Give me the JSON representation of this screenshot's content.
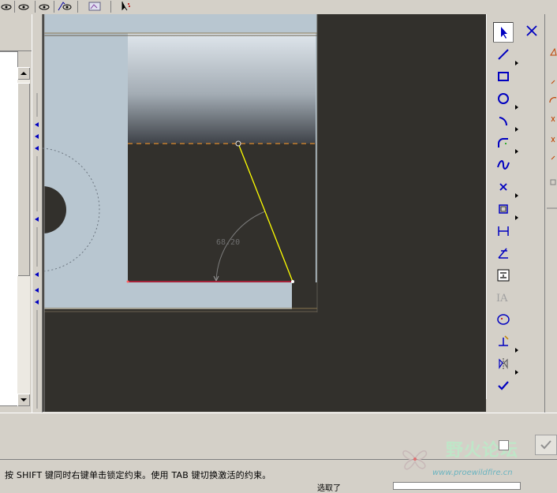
{
  "toolbar": {
    "icons": [
      "eye-icon",
      "eye-icon",
      "eye-icon",
      "layer-icon",
      "select-arrow-icon"
    ]
  },
  "sketch": {
    "angle_dimension": "68.20",
    "colors": {
      "background": "#32302c",
      "part_fill": "#b8c6d0",
      "highlight_line": "#ffff00",
      "selected_line": "#c81e3c",
      "reference_line": "#e08c2c",
      "tool_icon": "#0000c0"
    }
  },
  "sketch_tools": {
    "items": [
      {
        "name": "select",
        "icon": "arrow-cursor-icon",
        "has_menu": false
      },
      {
        "name": "line",
        "icon": "line-icon",
        "has_menu": true
      },
      {
        "name": "rectangle",
        "icon": "rectangle-icon",
        "has_menu": false
      },
      {
        "name": "circle",
        "icon": "circle-icon",
        "has_menu": true
      },
      {
        "name": "arc",
        "icon": "arc-icon",
        "has_menu": true
      },
      {
        "name": "fillet",
        "icon": "fillet-icon",
        "has_menu": true
      },
      {
        "name": "spline",
        "icon": "spline-icon",
        "has_menu": false
      },
      {
        "name": "point",
        "icon": "point-icon",
        "has_menu": true
      },
      {
        "name": "offset",
        "icon": "offset-icon",
        "has_menu": true
      },
      {
        "name": "dimension",
        "icon": "dimension-icon",
        "has_menu": false
      },
      {
        "name": "modify",
        "icon": "modify-icon",
        "has_menu": false
      },
      {
        "name": "constraint",
        "icon": "constraint-icon",
        "has_menu": false
      },
      {
        "name": "text",
        "icon": "text-icon",
        "has_menu": false
      },
      {
        "name": "palette",
        "icon": "palette-icon",
        "has_menu": false
      },
      {
        "name": "trim",
        "icon": "trim-icon",
        "has_menu": true
      },
      {
        "name": "mirror",
        "icon": "mirror-icon",
        "has_menu": true
      },
      {
        "name": "done",
        "icon": "checkmark-icon",
        "has_menu": false
      }
    ],
    "close_icon": "close-icon"
  },
  "status": {
    "message": "按 SHIFT 键同时右键单击锁定约束。使用 TAB 键切换激活的约束。",
    "filter_label": "选取了",
    "filter_value": ""
  },
  "watermark": {
    "title": "野火论坛",
    "url": "www.proewildfire.cn"
  }
}
